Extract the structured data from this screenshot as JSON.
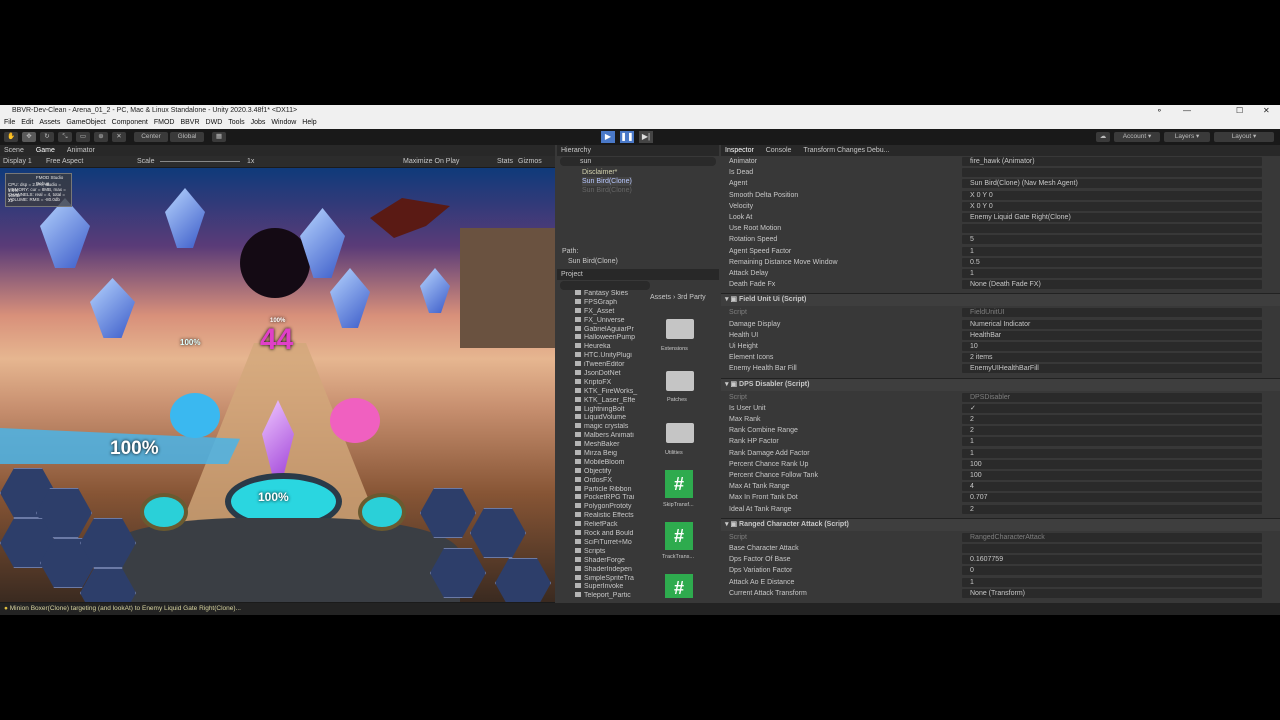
{
  "window": {
    "title": "BBVR-Dev-Clean - Arena_01_2 - PC, Mac & Linux Standalone - Unity 2020.3.48f1* <DX11>"
  },
  "menu": [
    "File",
    "Edit",
    "Assets",
    "GameObject",
    "Component",
    "FMOD",
    "BBVR",
    "DWD",
    "Tools",
    "Jobs",
    "Window",
    "Help"
  ],
  "toolbar": {
    "center": "Center",
    "global": "Global",
    "account": "Account",
    "layers": "Layers",
    "layout": "Layout"
  },
  "scene_tabs": [
    "Scene",
    "Game",
    "Animator"
  ],
  "game_bar": {
    "display": "Display 1",
    "aspect": "Free Aspect",
    "scale_label": "Scale",
    "scale_value": "1x",
    "maximize": "Maximize On Play",
    "stats": "Stats",
    "gizmos": "Gizmos"
  },
  "game": {
    "pct_big": "100%",
    "pct_center": "100%",
    "pct_small": "100%",
    "pct_top": "100%",
    "hit_number": "44"
  },
  "debug_overlay": {
    "title": "FMOD Studio Debug",
    "lines": [
      "CPU: dsp = 2.2%, studio = 1.4%",
      "MEMORY: cur = 8MB, max = 10MB",
      "CHANNELS: real = 4, total = 22",
      "VOLUME: RMS = -80.0db"
    ]
  },
  "hierarchy": {
    "tab": "Hierarchy",
    "search": "sun",
    "items": [
      "Disclaimer*",
      "Sun Bird(Clone)",
      "Sun Bird(Clone)"
    ],
    "path_label": "Path:",
    "path_value": "Sun Bird(Clone)"
  },
  "project": {
    "tab": "Project",
    "breadcrumb": [
      "Assets",
      "3rd Party"
    ],
    "tree": [
      "Fantasy Skies",
      "FPSGraph",
      "FX_Asset",
      "FX_Universe",
      "GabrielAguiarPr",
      "HalloweenPump",
      "Heureka",
      "HTC.UnityPlugi",
      "iTweenEditor",
      "JsonDotNet",
      "KriptoFX",
      "KTK_FireWorks_",
      "KTK_Laser_Effe",
      "LightningBolt",
      "LiquidVolume",
      "magic crystals",
      "Malbers Animati",
      "MeshBaker",
      "Mirza Beig",
      "MobileBloom",
      "Objectify",
      "OrdosFX",
      "Particle Ribbon",
      "PocketRPG Trai",
      "PolygonPrototy",
      "Realistic Effects",
      "ReliefPack",
      "Rock and Bould",
      "SciFiTurret+Mo",
      "Scripts",
      "ShaderForge",
      "ShaderIndepen",
      "SimpleSpriteTra",
      "SuperInvoke",
      "Teleport_Partic"
    ],
    "grid": [
      "Extensions",
      "Patches",
      "Utilities",
      "SkipTransf...",
      "TrackTrans..."
    ]
  },
  "inspector": {
    "tabs": [
      "Inspector",
      "Console",
      "Transform Changes Debu..."
    ],
    "rows_top": [
      {
        "label": "Animator",
        "value": "fire_hawk (Animator)"
      },
      {
        "label": "Is Dead",
        "value": ""
      },
      {
        "label": "Agent",
        "value": "Sun Bird(Clone) (Nav Mesh Agent)"
      },
      {
        "label": "Smooth Delta Position",
        "value": "X 0    Y 0"
      },
      {
        "label": "Velocity",
        "value": "X 0    Y 0"
      },
      {
        "label": "Look At",
        "value": "Enemy Liquid Gate Right(Clone)"
      },
      {
        "label": "Use Root Motion",
        "value": ""
      },
      {
        "label": "Rotation Speed",
        "value": "5"
      },
      {
        "label": "Agent Speed Factor",
        "value": "1"
      },
      {
        "label": "Remaining Distance Move Window",
        "value": "0.5"
      },
      {
        "label": "Attack Delay",
        "value": "1"
      },
      {
        "label": "Death Fade Fx",
        "value": "None (Death Fade FX)"
      }
    ],
    "comp1": {
      "title": "Field Unit Ui (Script)",
      "rows": [
        {
          "label": "Script",
          "value": "FieldUnitUI"
        },
        {
          "label": "Damage Display",
          "value": "Numerical Indicator"
        },
        {
          "label": "Health UI",
          "value": "HealthBar"
        },
        {
          "label": "Ui Height",
          "value": "10"
        },
        {
          "label": "Element Icons",
          "value": "2 items"
        },
        {
          "label": "Enemy Health Bar Fill",
          "value": "EnemyUIHealthBarFill"
        }
      ]
    },
    "comp2": {
      "title": "DPS Disabler (Script)",
      "rows": [
        {
          "label": "Script",
          "value": "DPSDisabler"
        },
        {
          "label": "Is User Unit",
          "value": "✓"
        },
        {
          "label": "Max Rank",
          "value": "2"
        },
        {
          "label": "Rank Combine Range",
          "value": "2"
        },
        {
          "label": "Rank HP Factor",
          "value": "1"
        },
        {
          "label": "Rank Damage Add Factor",
          "value": "1"
        },
        {
          "label": "Percent Chance Rank Up",
          "value": "100"
        },
        {
          "label": "Percent Chance Follow Tank",
          "value": "100"
        },
        {
          "label": "Max At Tank Range",
          "value": "4"
        },
        {
          "label": "Max In Front Tank Dot",
          "value": "0.707"
        },
        {
          "label": "Ideal At Tank Range",
          "value": "2"
        }
      ]
    },
    "comp3": {
      "title": "Ranged Character Attack (Script)",
      "rows": [
        {
          "label": "Script",
          "value": "RangedCharacterAttack"
        },
        {
          "label": "Base Character Attack",
          "value": ""
        },
        {
          "label": "Dps Factor Of Base",
          "value": "0.1607759"
        },
        {
          "label": "Dps Variation Factor",
          "value": "0"
        },
        {
          "label": "Attack Ao E Distance",
          "value": "1"
        },
        {
          "label": "Current Attack Transform",
          "value": "None (Transform)"
        }
      ]
    }
  },
  "status": {
    "message": "Minion Boxer(Clone) targeting (and lookAt) to Enemy Liquid Gate Right(Clone)..."
  }
}
